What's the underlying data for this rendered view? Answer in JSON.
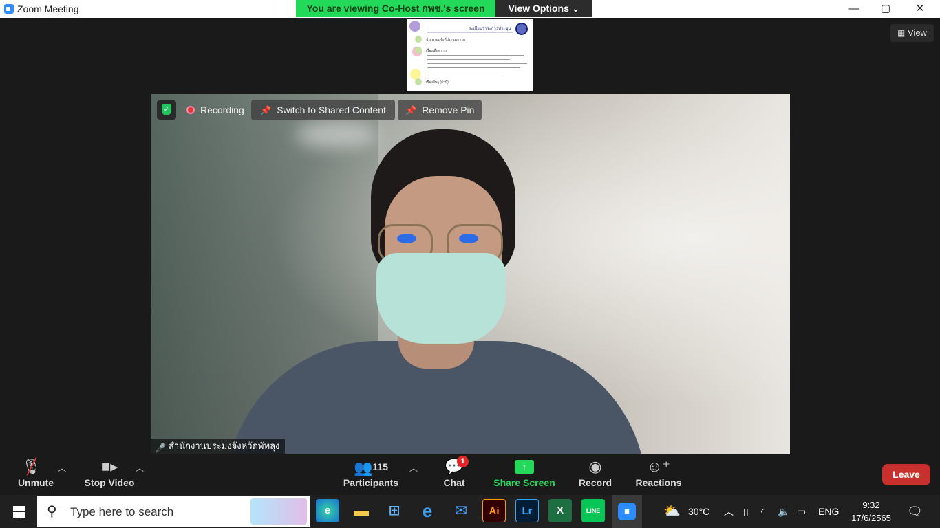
{
  "window": {
    "title": "Zoom Meeting",
    "controls": {
      "minimize": "—",
      "maximize": "▢",
      "close": "✕"
    }
  },
  "banner": {
    "viewing_text": "You are viewing Co-Host กพช.'s screen",
    "view_options_label": "View Options ⌄"
  },
  "top_right": {
    "view_label": "View"
  },
  "shared_thumbnail": {
    "heading": "ระเบียบวาระการประชุม",
    "items": [
      "ประธานแจ้งที่ประชุมทราบ",
      "เรื่องเพื่อทราบ",
      "เรื่องอื่นๆ (ถ้ามี)"
    ]
  },
  "video": {
    "recording_label": "Recording",
    "switch_label": "Switch to Shared Content",
    "remove_pin_label": "Remove Pin",
    "participant_name": "สำนักงานประมงจังหวัดพัทลุง"
  },
  "toolbar": {
    "unmute": "Unmute",
    "stop_video": "Stop Video",
    "participants": "Participants",
    "participants_count": "115",
    "chat": "Chat",
    "chat_badge": "1",
    "share_screen": "Share Screen",
    "record": "Record",
    "reactions": "Reactions",
    "leave": "Leave"
  },
  "taskbar": {
    "search_placeholder": "Type here to search",
    "apps": [
      "edge-icon",
      "file-explorer-icon",
      "store-icon",
      "internet-explorer-icon",
      "mail-icon",
      "illustrator-icon",
      "lightroom-icon",
      "excel-icon",
      "line-icon",
      "zoom-icon"
    ],
    "illustrator_label": "Ai",
    "lightroom_label": "Lr",
    "line_label": "LINE",
    "temperature": "30°C",
    "language": "ENG",
    "time": "9:32",
    "date": "17/6/2565"
  },
  "colors": {
    "banner_green": "#23d959",
    "share_green": "#23d959",
    "leave_red": "#c7302c",
    "badge_red": "#e02828"
  }
}
